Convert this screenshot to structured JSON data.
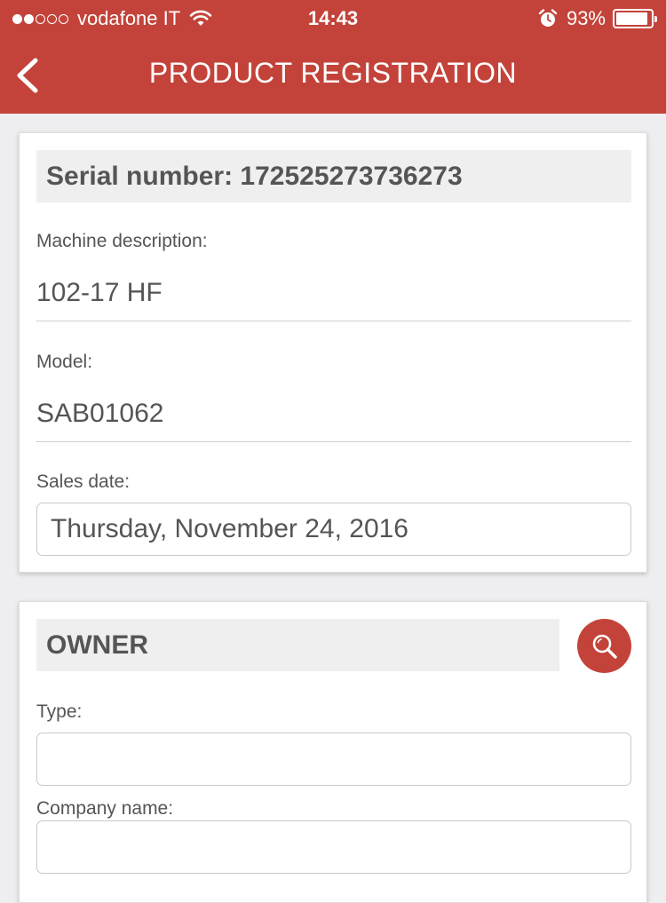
{
  "status_bar": {
    "carrier": "vodafone IT",
    "time": "14:43",
    "battery_percent": "93%",
    "battery_level": 0.93,
    "signal_bars_filled": 2,
    "signal_bars_total": 5,
    "icons": [
      "wifi-icon",
      "alarm-icon",
      "battery-icon"
    ]
  },
  "nav": {
    "title": "PRODUCT REGISTRATION",
    "back_icon": "chevron-left-icon"
  },
  "product": {
    "serial_label": "Serial number: 172525273736273",
    "machine_description_label": "Machine description:",
    "machine_description_value": "102-17 HF",
    "model_label": "Model:",
    "model_value": "SAB01062",
    "sales_date_label": "Sales date:",
    "sales_date_value": "Thursday, November 24, 2016"
  },
  "owner": {
    "title": "OWNER",
    "search_icon": "search-icon",
    "type_label": "Type:",
    "type_value": "",
    "company_name_label": "Company name:",
    "company_name_value": ""
  },
  "colors": {
    "accent": "#c3433a",
    "background": "#eeeef0",
    "section_header_bg": "#efefef",
    "text": "#555555"
  }
}
